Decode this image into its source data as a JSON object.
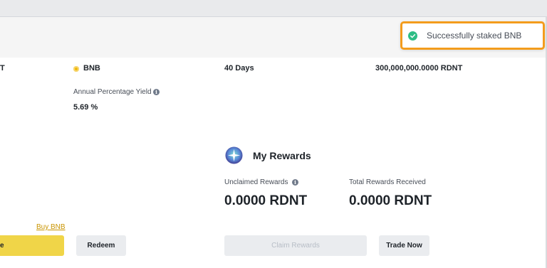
{
  "toast": {
    "message": "Successfully staked BNB",
    "icon": "check-circle-icon",
    "color": "#2ebd85"
  },
  "product_row": {
    "col1_partial": "T",
    "coin": "BNB",
    "duration": "40 Days",
    "pool_cap": "300,000,000.0000 RDNT"
  },
  "apy": {
    "label": "Annual Percentage Yield",
    "value": "5.69 %"
  },
  "rewards": {
    "title": "My Rewards",
    "unclaimed_label": "Unclaimed Rewards",
    "unclaimed_value": "0.0000 RDNT",
    "total_label": "Total Rewards Received",
    "total_value": "0.0000 RDNT"
  },
  "actions": {
    "buy_link": "Buy BNB",
    "primary_partial": "e",
    "redeem": "Redeem",
    "claim": "Claim Rewards",
    "trade": "Trade Now"
  },
  "colors": {
    "accent": "#f0b90b",
    "toast_border": "#f39c1d",
    "link": "#c99400"
  }
}
